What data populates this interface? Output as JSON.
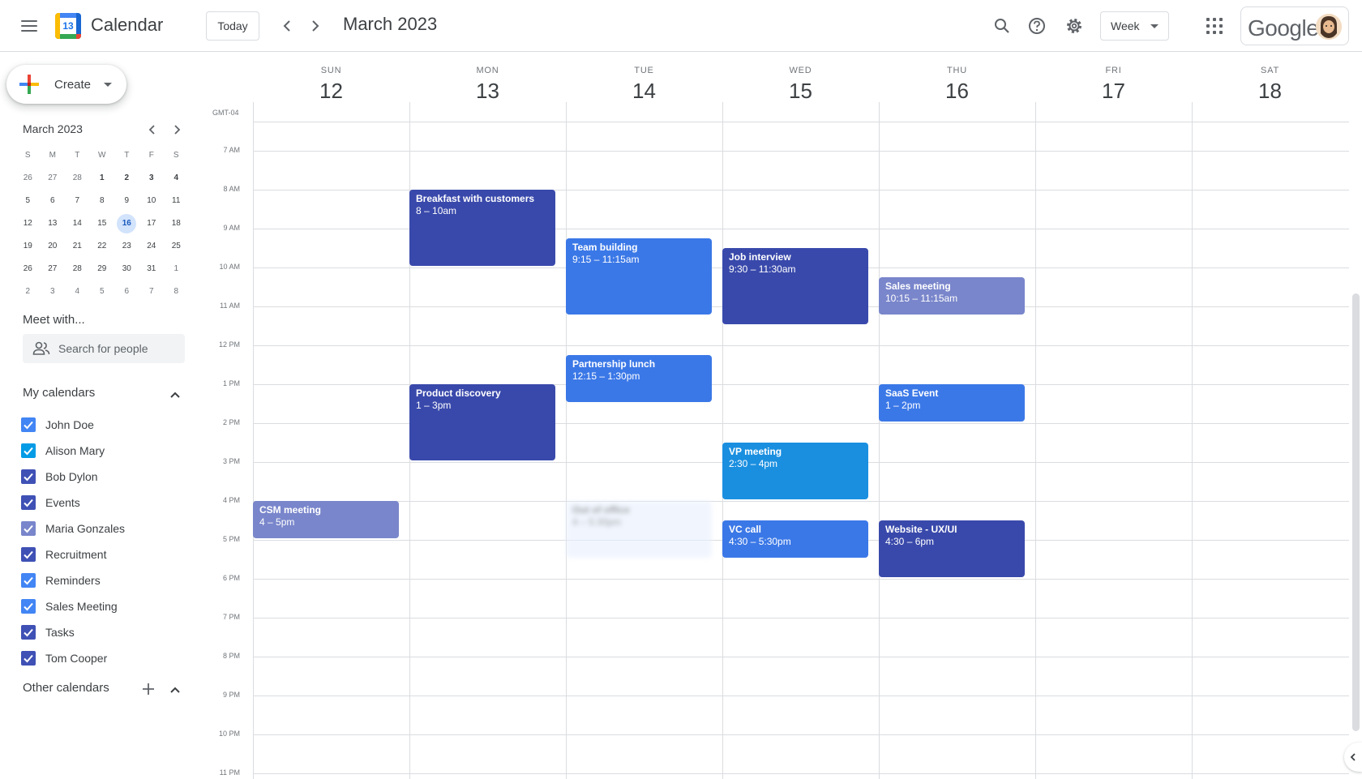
{
  "header": {
    "app_title": "Calendar",
    "logo_day": "13",
    "today_label": "Today",
    "current_range": "March 2023",
    "view_label": "Week",
    "brand_word": "Google"
  },
  "sidebar": {
    "create_label": "Create",
    "mini_calendar": {
      "title": "March 2023",
      "weekday_heads": [
        "S",
        "M",
        "T",
        "W",
        "T",
        "F",
        "S"
      ],
      "weeks": [
        [
          "26",
          "27",
          "28",
          "1",
          "2",
          "3",
          "4"
        ],
        [
          "5",
          "6",
          "7",
          "8",
          "9",
          "10",
          "11"
        ],
        [
          "12",
          "13",
          "14",
          "15",
          "16",
          "17",
          "18"
        ],
        [
          "19",
          "20",
          "21",
          "22",
          "23",
          "24",
          "25"
        ],
        [
          "26",
          "27",
          "28",
          "29",
          "30",
          "31",
          "1"
        ],
        [
          "2",
          "3",
          "4",
          "5",
          "6",
          "7",
          "8"
        ]
      ],
      "selected": "16"
    },
    "meet_title": "Meet with...",
    "search_placeholder": "Search for people",
    "my_calendars_title": "My calendars",
    "my_calendars": [
      {
        "name": "John Doe",
        "color": "#4285f4"
      },
      {
        "name": "Alison Mary",
        "color": "#039be5"
      },
      {
        "name": "Bob Dylon",
        "color": "#3f51b5"
      },
      {
        "name": "Events",
        "color": "#3f51b5"
      },
      {
        "name": "Maria Gonzales",
        "color": "#7986cb"
      },
      {
        "name": "Recruitment",
        "color": "#3f51b5"
      },
      {
        "name": "Reminders",
        "color": "#4285f4"
      },
      {
        "name": "Sales Meeting",
        "color": "#4285f4"
      },
      {
        "name": "Tasks",
        "color": "#3f51b5"
      },
      {
        "name": "Tom Cooper",
        "color": "#3f51b5"
      }
    ],
    "other_calendars_title": "Other calendars"
  },
  "week": {
    "timezone": "GMT-04",
    "days": [
      {
        "name": "SUN",
        "num": "12"
      },
      {
        "name": "MON",
        "num": "13"
      },
      {
        "name": "TUE",
        "num": "14"
      },
      {
        "name": "WED",
        "num": "15"
      },
      {
        "name": "THU",
        "num": "16"
      },
      {
        "name": "FRI",
        "num": "17"
      },
      {
        "name": "SAT",
        "num": "18"
      }
    ],
    "hours": [
      "7 AM",
      "8 AM",
      "9 AM",
      "10 AM",
      "11 AM",
      "12 PM",
      "1 PM",
      "2 PM",
      "3 PM",
      "4 PM",
      "5 PM",
      "6 PM",
      "7 PM",
      "8 PM",
      "9 PM",
      "10 PM",
      "11 PM"
    ],
    "events": [
      {
        "title": "Breakfast with customers",
        "time": "8 – 10am",
        "day": 1,
        "start": 8,
        "end": 10,
        "color": "#3949ab"
      },
      {
        "title": "Team building",
        "time": "9:15 – 11:15am",
        "day": 2,
        "start": 9.25,
        "end": 11.25,
        "color": "#3b78e7"
      },
      {
        "title": "Job interview",
        "time": "9:30 – 11:30am",
        "day": 3,
        "start": 9.5,
        "end": 11.5,
        "color": "#3949ab"
      },
      {
        "title": "Sales meeting",
        "time": "10:15 – 11:15am",
        "day": 4,
        "start": 10.25,
        "end": 11.25,
        "color": "#7986cb"
      },
      {
        "title": "Partnership lunch",
        "time": "12:15 – 1:30pm",
        "day": 2,
        "start": 12.25,
        "end": 13.5,
        "color": "#3b78e7"
      },
      {
        "title": "Product discovery",
        "time": "1 – 3pm",
        "day": 1,
        "start": 13,
        "end": 15,
        "color": "#3949ab"
      },
      {
        "title": "SaaS Event",
        "time": "1 – 2pm",
        "day": 4,
        "start": 13,
        "end": 14,
        "color": "#3b78e7"
      },
      {
        "title": "VP meeting",
        "time": "2:30 – 4pm",
        "day": 3,
        "start": 14.5,
        "end": 16,
        "color": "#1a8fe0"
      },
      {
        "title": "CSM meeting",
        "time": "4 – 5pm",
        "day": 0,
        "start": 16,
        "end": 17,
        "color": "#7986cb"
      },
      {
        "title": "Out of office",
        "time": "4 – 5:30pm",
        "day": 2,
        "start": 16,
        "end": 17.5,
        "color": "#e8f0fe",
        "blurred": true
      },
      {
        "title": "VC call",
        "time": "4:30 – 5:30pm",
        "day": 3,
        "start": 16.5,
        "end": 17.5,
        "color": "#3b78e7"
      },
      {
        "title": "Website - UX/UI",
        "time": "4:30 – 6pm",
        "day": 4,
        "start": 16.5,
        "end": 18,
        "color": "#3949ab"
      }
    ]
  }
}
